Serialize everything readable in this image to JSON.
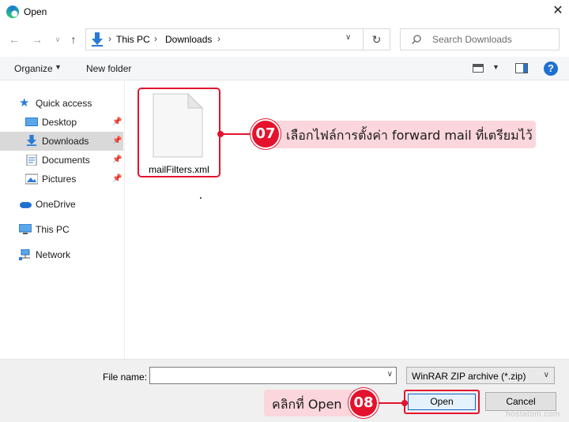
{
  "window": {
    "title": "Open"
  },
  "address": {
    "crumbs": [
      "This PC",
      "Downloads"
    ],
    "search_placeholder": "Search Downloads"
  },
  "toolbar": {
    "organize": "Organize",
    "new_folder": "New folder"
  },
  "nav": {
    "items": [
      {
        "label": "Quick access",
        "icon": "star-icon"
      },
      {
        "label": "Desktop",
        "icon": "desktop-icon",
        "pinned": true
      },
      {
        "label": "Downloads",
        "icon": "download-arrow-icon",
        "pinned": true,
        "selected": true
      },
      {
        "label": "Documents",
        "icon": "document-icon",
        "pinned": true
      },
      {
        "label": "Pictures",
        "icon": "picture-icon",
        "pinned": true
      },
      {
        "label": "OneDrive",
        "icon": "cloud-icon"
      },
      {
        "label": "This PC",
        "icon": "computer-icon"
      },
      {
        "label": "Network",
        "icon": "network-icon"
      }
    ]
  },
  "files": [
    {
      "name": "mailFilters.xml",
      "icon": "blank-file-icon"
    }
  ],
  "annotations": {
    "step1": {
      "number": "07",
      "text": "เลือกไฟล์การตั้งค่า forward mail ที่เตรียมไว้"
    },
    "step2": {
      "number": "08",
      "text": "คลิกที่ Open"
    }
  },
  "bottom": {
    "filename_label": "File name:",
    "filename_value": "",
    "filetype": "WinRAR ZIP archive (*.zip)",
    "open": "Open",
    "cancel": "Cancel"
  },
  "watermark": "hostatom.com",
  "colors": {
    "accent_red": "#e3132d",
    "callout_bg": "#fbd6dc",
    "selection": "#d9d9d9",
    "primary_button_border": "#0a64c8"
  }
}
